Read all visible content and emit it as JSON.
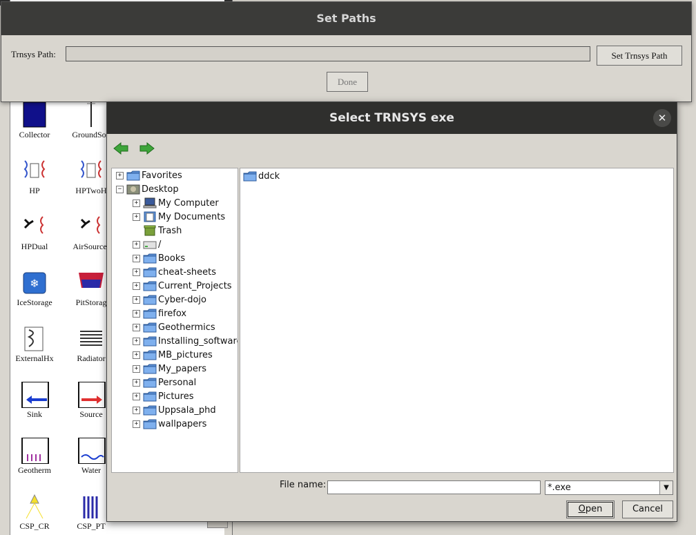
{
  "palette": {
    "components": [
      {
        "label": "Collector",
        "icon": "collector-icon"
      },
      {
        "label": "GroundSou",
        "icon": "ground-source-icon"
      },
      {
        "label": "HP",
        "icon": "heat-pump-icon"
      },
      {
        "label": "HPTwoH",
        "icon": "heat-pump-two-icon"
      },
      {
        "label": "HPDual",
        "icon": "heat-pump-dual-icon"
      },
      {
        "label": "AirSourceI",
        "icon": "air-source-icon"
      },
      {
        "label": "IceStorage",
        "icon": "ice-storage-icon"
      },
      {
        "label": "PitStorag",
        "icon": "pit-storage-icon"
      },
      {
        "label": "ExternalHx",
        "icon": "external-hx-icon"
      },
      {
        "label": "Radiator",
        "icon": "radiator-icon"
      },
      {
        "label": "Sink",
        "icon": "sink-icon"
      },
      {
        "label": "Source",
        "icon": "source-icon"
      },
      {
        "label": "Geotherm",
        "icon": "geotherm-icon"
      },
      {
        "label": "Water",
        "icon": "water-icon"
      },
      {
        "label": "CSP_CR",
        "icon": "csp-cr-icon"
      },
      {
        "label": "CSP_PT",
        "icon": "csp-pt-icon"
      }
    ]
  },
  "set_paths": {
    "title": "Set Paths",
    "trnsys_label": "Trnsys Path:",
    "trnsys_value": "",
    "set_button": "Set Trnsys Path",
    "done_button": "Done"
  },
  "dialog": {
    "title": "Select TRNSYS exe",
    "close_glyph": "✕",
    "tree": [
      {
        "label": "Favorites",
        "level": 0,
        "expander": "+",
        "icon": "folder-icon"
      },
      {
        "label": "Desktop",
        "level": 0,
        "expander": "−",
        "icon": "desktop-icon"
      },
      {
        "label": "My Computer",
        "level": 1,
        "expander": "+",
        "icon": "computer-icon"
      },
      {
        "label": "My Documents",
        "level": 1,
        "expander": "+",
        "icon": "documents-icon"
      },
      {
        "label": "Trash",
        "level": 1,
        "expander": "",
        "icon": "trash-icon"
      },
      {
        "label": "/",
        "level": 1,
        "expander": "+",
        "icon": "drive-icon"
      },
      {
        "label": "Books",
        "level": 1,
        "expander": "+",
        "icon": "folder-icon"
      },
      {
        "label": "cheat-sheets",
        "level": 1,
        "expander": "+",
        "icon": "folder-icon"
      },
      {
        "label": "Current_Projects",
        "level": 1,
        "expander": "+",
        "icon": "folder-icon"
      },
      {
        "label": "Cyber-dojo",
        "level": 1,
        "expander": "+",
        "icon": "folder-icon"
      },
      {
        "label": "firefox",
        "level": 1,
        "expander": "+",
        "icon": "folder-icon"
      },
      {
        "label": "Geothermics",
        "level": 1,
        "expander": "+",
        "icon": "folder-icon"
      },
      {
        "label": "Installing_software",
        "level": 1,
        "expander": "+",
        "icon": "folder-icon"
      },
      {
        "label": "MB_pictures",
        "level": 1,
        "expander": "+",
        "icon": "folder-icon"
      },
      {
        "label": "My_papers",
        "level": 1,
        "expander": "+",
        "icon": "folder-icon"
      },
      {
        "label": "Personal",
        "level": 1,
        "expander": "+",
        "icon": "folder-icon"
      },
      {
        "label": "Pictures",
        "level": 1,
        "expander": "+",
        "icon": "folder-icon"
      },
      {
        "label": "Uppsala_phd",
        "level": 1,
        "expander": "+",
        "icon": "folder-icon"
      },
      {
        "label": "wallpapers",
        "level": 1,
        "expander": "+",
        "icon": "folder-icon"
      }
    ],
    "files": [
      {
        "label": "ddck",
        "icon": "folder-icon"
      }
    ],
    "file_name_label": "File name:",
    "file_name_value": "",
    "filter_value": "*.exe",
    "open_button_accel": "O",
    "open_button_rest": "pen",
    "cancel_button": "Cancel"
  },
  "colors": {
    "titlebar": "#2f2f2d",
    "window_bg": "#d9d6cf",
    "folder_blue": "#5b8fd4",
    "nav_green": "#3ea53a"
  }
}
